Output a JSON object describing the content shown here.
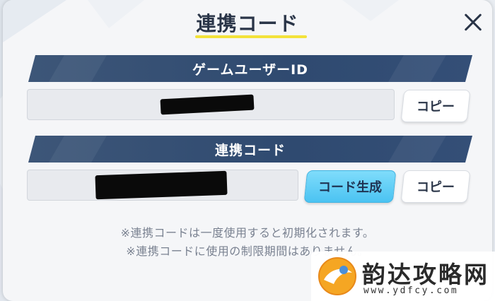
{
  "dialog": {
    "title": "連携コード",
    "close_icon": "close-icon"
  },
  "user_id_section": {
    "header": "ゲームユーザーID",
    "field_value": "",
    "copy_label": "コピー"
  },
  "link_code_section": {
    "header": "連携コード",
    "field_value": "",
    "generate_label": "コード生成",
    "copy_label": "コピー"
  },
  "notes": [
    "※連携コードは一度使用すると初期化されます。",
    "※連携コードに使用の制限期間はありません。"
  ],
  "watermark": {
    "name": "韵达攻略网",
    "url": "www.ydfcy.com"
  },
  "colors": {
    "section_bar": "#2f4a70",
    "generate_button": "#4bc3f2",
    "title_underline": "#f3e23a",
    "title_text": "#2a3548"
  }
}
